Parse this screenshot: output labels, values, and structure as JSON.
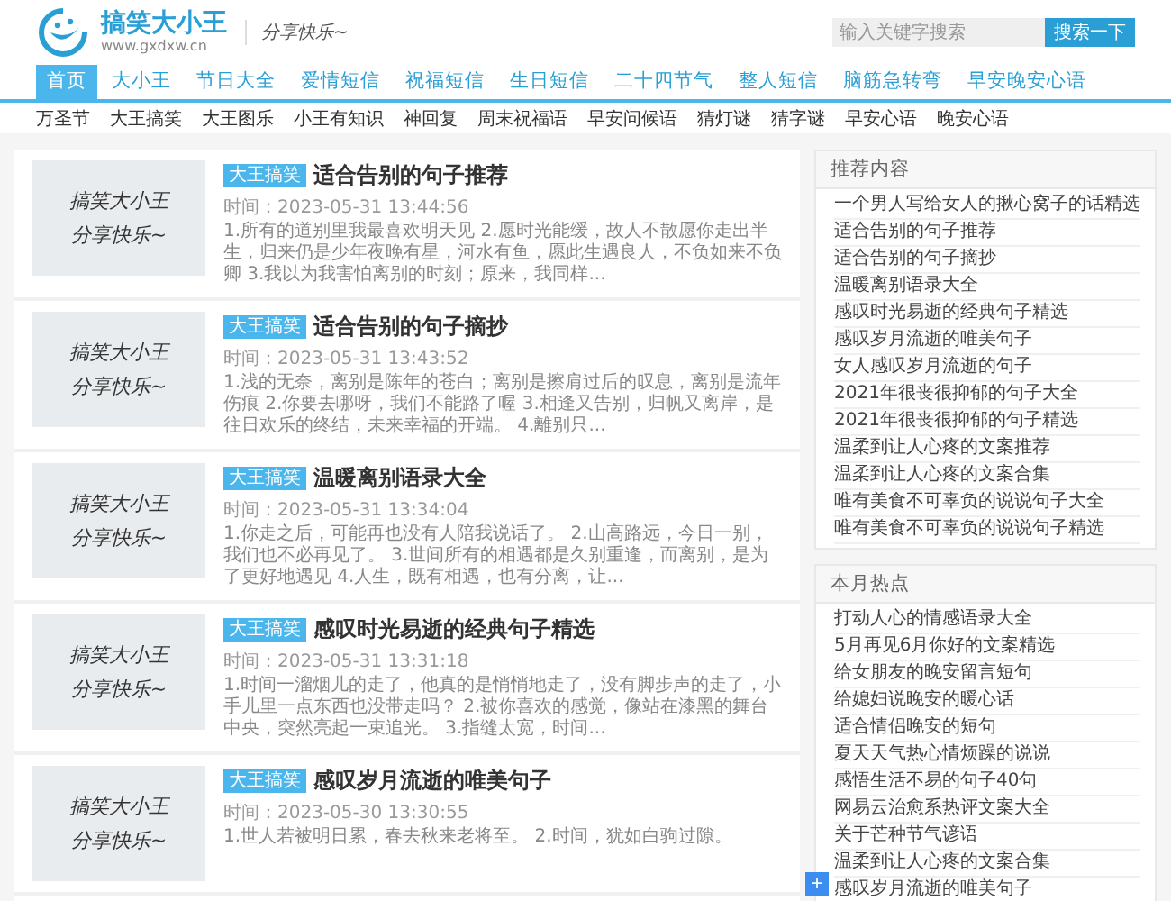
{
  "header": {
    "logo_title": "搞笑大小王",
    "logo_url": "www.gxdxw.cn",
    "slogan": "分享快乐~"
  },
  "search": {
    "placeholder": "输入关键字搜索",
    "button": "搜索一下"
  },
  "nav": [
    {
      "label": "首页",
      "selected": true
    },
    {
      "label": "大小王",
      "selected": false
    },
    {
      "label": "节日大全",
      "selected": false
    },
    {
      "label": "爱情短信",
      "selected": false
    },
    {
      "label": "祝福短信",
      "selected": false
    },
    {
      "label": "生日短信",
      "selected": false
    },
    {
      "label": "二十四节气",
      "selected": false
    },
    {
      "label": "整人短信",
      "selected": false
    },
    {
      "label": "脑筋急转弯",
      "selected": false
    },
    {
      "label": "早安晚安心语",
      "selected": false
    }
  ],
  "subnav": [
    "万圣节",
    "大王搞笑",
    "大王图乐",
    "小王有知识",
    "神回复",
    "周末祝福语",
    "早安问候语",
    "猜灯谜",
    "猜字谜",
    "早安心语",
    "晚安心语"
  ],
  "articles": [
    {
      "thumb_text": [
        "搞笑大小王",
        "分享快乐~"
      ],
      "tag": "大王搞笑",
      "title": "适合告别的句子推荐",
      "time": "时间：2023-05-31 13:44:56",
      "excerpt": "1.所有的道别里我最喜欢明天见 2.愿时光能缓，故人不散愿你走出半生，归来仍是少年夜晚有星，河水有鱼，愿此生遇良人，不负如来不负卿 3.我以为我害怕离别的时刻；原来，我同样..."
    },
    {
      "thumb_text": [
        "搞笑大小王",
        "分享快乐~"
      ],
      "tag": "大王搞笑",
      "title": "适合告别的句子摘抄",
      "time": "时间：2023-05-31 13:43:52",
      "excerpt": "1.浅的无奈，离别是陈年的苍白；离别是擦肩过后的叹息，离别是流年伤痕 2.你要去哪呀，我们不能路了喔 3.相逢又告别，归帆又离岸，是往日欢乐的终结，未来幸福的开端。 4.離别只..."
    },
    {
      "thumb_text": [
        "搞笑大小王",
        "分享快乐~"
      ],
      "tag": "大王搞笑",
      "title": "温暖离别语录大全",
      "time": "时间：2023-05-31 13:34:04",
      "excerpt": "1.你走之后，可能再也没有人陪我说话了。 2.山高路远，今日一别，我们也不必再见了。 3.世间所有的相遇都是久别重逢，而离别，是为了更好地遇见 4.人生，既有相遇，也有分离，让..."
    },
    {
      "thumb_text": [
        "搞笑大小王",
        "分享快乐~"
      ],
      "tag": "大王搞笑",
      "title": "感叹时光易逝的经典句子精选",
      "time": "时间：2023-05-31 13:31:18",
      "excerpt": "1.时间一溜烟儿的走了，他真的是悄悄地走了，没有脚步声的走了，小手儿里一点东西也没带走吗？ 2.被你喜欢的感觉，像站在漆黑的舞台中央，突然亮起一束追光。 3.指缝太宽，时间..."
    },
    {
      "thumb_text": [
        "搞笑大小王",
        "分享快乐~"
      ],
      "tag": "大王搞笑",
      "title": "感叹岁月流逝的唯美句子",
      "time": "时间：2023-05-30 13:30:55",
      "excerpt": "1.世人若被明日累，春去秋来老将至。 2.时间，犹如白驹过隙。"
    }
  ],
  "sidebar": [
    {
      "title": "推荐内容",
      "items": [
        "一个男人写给女人的揪心窝子的话精选",
        "适合告别的句子推荐",
        "适合告别的句子摘抄",
        "温暖离别语录大全",
        "感叹时光易逝的经典句子精选",
        "感叹岁月流逝的唯美句子",
        "女人感叹岁月流逝的句子",
        "2021年很丧很抑郁的句子大全",
        "2021年很丧很抑郁的句子精选",
        "温柔到让人心疼的文案推荐",
        "温柔到让人心疼的文案合集",
        "唯有美食不可辜负的说说句子大全",
        "唯有美食不可辜负的说说句子精选"
      ]
    },
    {
      "title": "本月热点",
      "items": [
        "打动人心的情感语录大全",
        "5月再见6月你好的文案精选",
        "给女朋友的晚安留言短句",
        "给媳妇说晚安的暖心话",
        "适合情侣晚安的短句",
        "夏天天气热心情烦躁的说说",
        "感悟生活不易的句子40句",
        "网易云治愈系热评文案大全",
        "关于芒种节气谚语",
        "温柔到让人心疼的文案合集",
        "感叹岁月流逝的唯美句子"
      ]
    }
  ],
  "float_button": "+"
}
